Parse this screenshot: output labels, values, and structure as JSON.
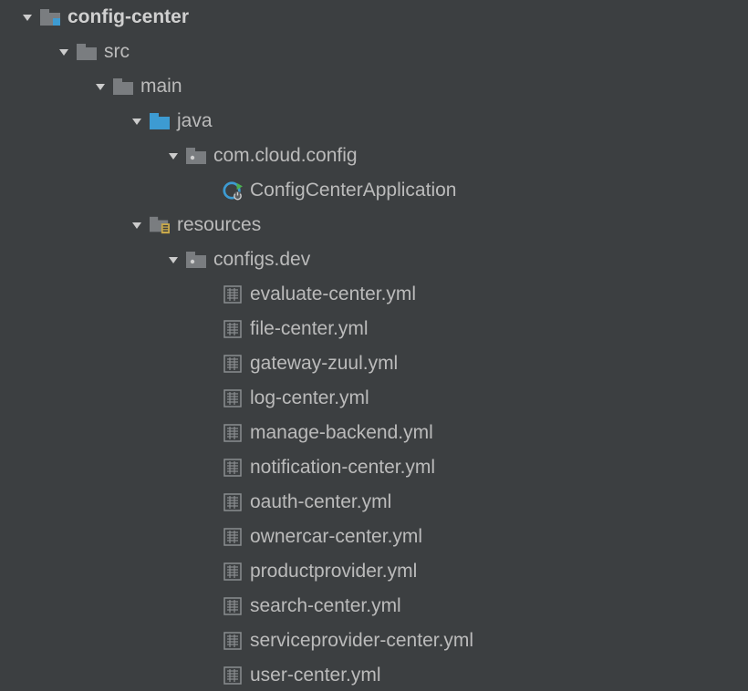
{
  "tree": {
    "root": {
      "label": "config-center"
    },
    "src": {
      "label": "src"
    },
    "main": {
      "label": "main"
    },
    "java": {
      "label": "java"
    },
    "pkg": {
      "label": "com.cloud.config"
    },
    "app": {
      "label": "ConfigCenterApplication"
    },
    "resources": {
      "label": "resources"
    },
    "configsdev": {
      "label": "configs.dev"
    },
    "files": [
      "evaluate-center.yml",
      "file-center.yml",
      "gateway-zuul.yml",
      "log-center.yml",
      "manage-backend.yml",
      "notification-center.yml",
      "oauth-center.yml",
      "ownercar-center.yml",
      "productprovider.yml",
      "search-center.yml",
      "serviceprovider-center.yml",
      "user-center.yml"
    ]
  }
}
